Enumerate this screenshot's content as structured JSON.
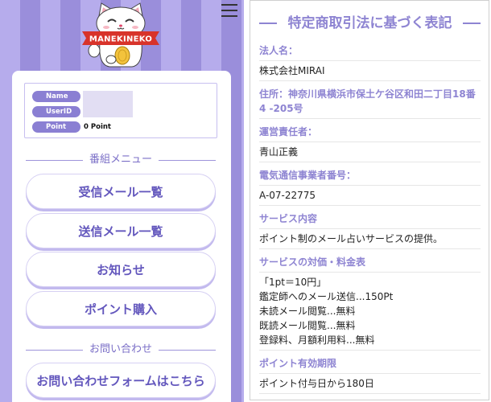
{
  "header": {
    "logo_text": "MANEKINEKO",
    "menu_icon": "hamburger-menu-icon"
  },
  "profile": {
    "name_label": "Name",
    "userid_label": "UserID",
    "point_label": "Point",
    "point_value": "0 Point"
  },
  "menu": {
    "section_title": "番組メニュー",
    "items": [
      "受信メール一覧",
      "送信メール一覧",
      "お知らせ",
      "ポイント購入"
    ]
  },
  "contact": {
    "section_title": "お問い合わせ",
    "button_label": "お問い合わせフォームはこちら"
  },
  "legal": {
    "title": "特定商取引法に基づく表記",
    "sections": [
      {
        "heading": "法人名：",
        "values": [
          "株式会社MIRAI"
        ]
      },
      {
        "heading": "住所：神奈川県横浜市保土ケ谷区和田二丁目18番4 -205号",
        "values": []
      },
      {
        "heading": "運営責任者：",
        "values": [
          "青山正義"
        ]
      },
      {
        "heading": "電気通信事業者番号：",
        "values": [
          "A-07-22775"
        ]
      },
      {
        "heading": "サービス内容",
        "values": [
          "ポイント制のメール占いサービスの提供。"
        ]
      },
      {
        "heading": "サービスの対価・料金表",
        "values": [
          "「1pt＝10円」",
          "鑑定師へのメール送信...150Pt",
          "未読メール閲覧...無料",
          "既読メール閲覧...無料",
          "登録料、月額利用料...無料"
        ]
      },
      {
        "heading": "ポイント有効期限",
        "values": [
          "ポイント付与日から180日"
        ]
      }
    ]
  },
  "colors": {
    "accent": "#8e84d2",
    "button_text": "#6357bd",
    "stripe_light": "#b6acec",
    "stripe_dark": "#9a8edb",
    "pill": "#8a7fd3",
    "banner_red": "#d8332a",
    "coin_gold": "#f3c33c"
  }
}
